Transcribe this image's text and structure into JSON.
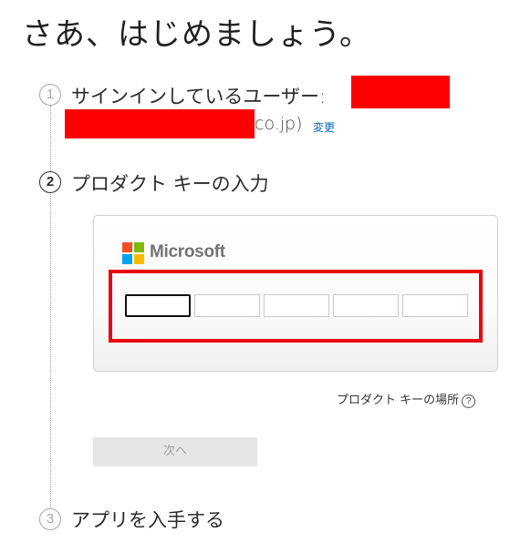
{
  "header": {
    "title": "さあ、はじめましょう。"
  },
  "steps": [
    {
      "number": "1",
      "label": "サインインしているユーザー:"
    },
    {
      "number": "2",
      "label": "プロダクト キーの入力"
    },
    {
      "number": "3",
      "label": "アプリを入手する"
    }
  ],
  "account": {
    "email_visible_suffix": "co.jp)",
    "change_label": "変更"
  },
  "product_key": {
    "brand": "Microsoft",
    "fields": [
      "",
      "",
      "",
      "",
      ""
    ],
    "help_label": "プロダクト キーの場所",
    "help_icon_glyph": "?",
    "next_label": "次へ"
  },
  "colors": {
    "logo_red": "#f25022",
    "logo_green": "#7fba00",
    "logo_blue": "#00a4ef",
    "logo_yellow": "#ffb900",
    "highlight": "#e8050d",
    "link": "#0067b8"
  }
}
